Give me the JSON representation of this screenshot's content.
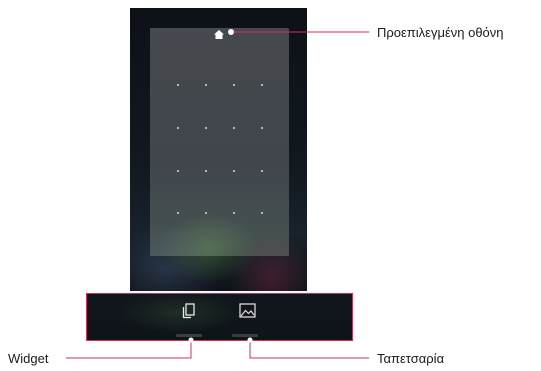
{
  "callouts": {
    "default_screen": "Προεπιλεγμένη οθόνη",
    "widget": "Widget",
    "wallpaper": "Ταπετσαρία"
  },
  "icons": {
    "home": "home-icon",
    "widget": "widget-icon",
    "wallpaper": "wallpaper-icon"
  },
  "colors": {
    "highlight_border": "#d0315a",
    "callout_line": "#d0315a"
  }
}
